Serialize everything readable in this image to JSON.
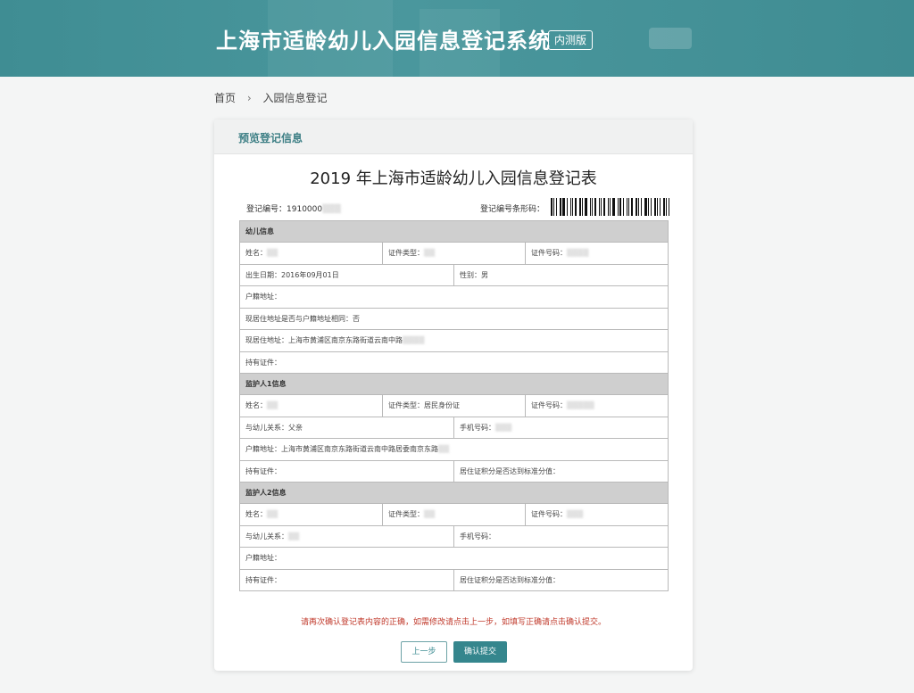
{
  "header": {
    "title": "上海市适龄幼儿入园信息登记系统",
    "badge": "内测版"
  },
  "breadcrumb": {
    "home": "首页",
    "separator": "›",
    "current": "入园信息登记"
  },
  "card": {
    "header_label": "预览登记信息",
    "form_title": "2019 年上海市适龄幼儿入园信息登记表",
    "reg_no_label": "登记编号：",
    "reg_no_value": "1910000",
    "barcode_label": "登记编号条形码："
  },
  "table": {
    "child_section": "幼儿信息",
    "child": {
      "name_label": "姓名：",
      "id_type_label": "证件类型：",
      "id_no_label": "证件号码：",
      "birth_label": "出生日期：",
      "birth_value": "2016年09月01日",
      "gender_label": "性别：",
      "gender_value": "男",
      "hukou_addr_label": "户籍地址：",
      "same_addr_label": "现居住地址是否与户籍地址相同：",
      "same_addr_value": "否",
      "current_addr_label": "现居住地址：",
      "current_addr_value": "上海市黄浦区南京东路街道云南中路",
      "held_cert_label": "持有证件："
    },
    "guardian1_section": "监护人1信息",
    "guardian1": {
      "name_label": "姓名：",
      "id_type_label": "证件类型：",
      "id_type_value": "居民身份证",
      "id_no_label": "证件号码：",
      "relation_label": "与幼儿关系：",
      "relation_value": "父亲",
      "phone_label": "手机号码：",
      "hukou_addr_label": "户籍地址：",
      "hukou_addr_value": "上海市黄浦区南京东路街道云南中路居委南京东路",
      "held_cert_label": "持有证件：",
      "residence_score_label": "居住证积分是否达到标准分值："
    },
    "guardian2_section": "监护人2信息",
    "guardian2": {
      "name_label": "姓名：",
      "id_type_label": "证件类型：",
      "id_no_label": "证件号码：",
      "relation_label": "与幼儿关系：",
      "phone_label": "手机号码：",
      "hukou_addr_label": "户籍地址：",
      "held_cert_label": "持有证件：",
      "residence_score_label": "居住证积分是否达到标准分值："
    }
  },
  "notice": "请再次确认登记表内容的正确，如需修改请点击上一步，如填写正确请点击确认提交。",
  "buttons": {
    "prev": "上一步",
    "submit": "确认提交"
  },
  "colors": {
    "header_bg": "#4a979d",
    "accent": "#35868d",
    "notice": "#c0392b"
  }
}
